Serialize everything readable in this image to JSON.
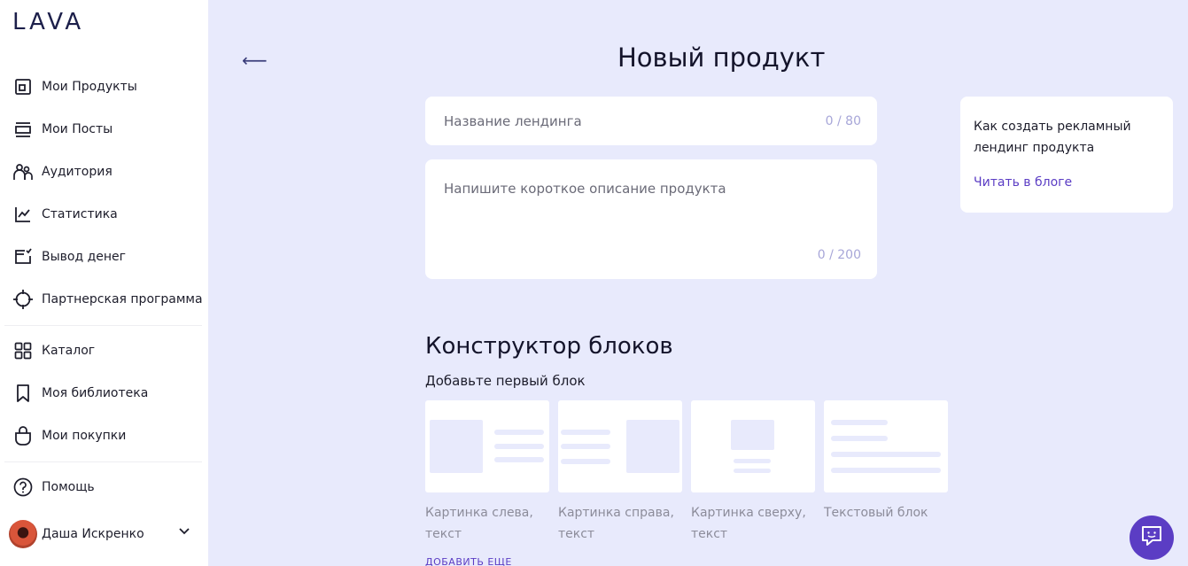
{
  "brand": {
    "logo": "LAVA"
  },
  "sidebar": {
    "items": [
      {
        "label": "Мои Продукты",
        "icon": "products-icon"
      },
      {
        "label": "Мои Посты",
        "icon": "posts-icon"
      },
      {
        "label": "Аудитория",
        "icon": "audience-icon"
      },
      {
        "label": "Статистика",
        "icon": "statistics-icon"
      },
      {
        "label": "Вывод денег",
        "icon": "withdraw-icon"
      },
      {
        "label": "Партнерская программа",
        "icon": "partner-icon"
      },
      {
        "label": "Каталог",
        "icon": "catalog-icon"
      },
      {
        "label": "Моя библиотека",
        "icon": "bookmark-icon"
      },
      {
        "label": "Мои покупки",
        "icon": "shopping-bag-icon"
      },
      {
        "label": "Помощь",
        "icon": "help-icon"
      }
    ],
    "user": {
      "name": "Даша Искренко"
    }
  },
  "header": {
    "back_symbol": "⟵",
    "title": "Новый продукт"
  },
  "form": {
    "landing_name": {
      "placeholder": "Название лендинга",
      "counter": "0 / 80"
    },
    "description": {
      "placeholder": "Напишите короткое описание продукта",
      "counter": "0 / 200"
    }
  },
  "tip": {
    "text": "Как создать рекламный лендинг продукта",
    "link": "Читать в блоге"
  },
  "constructor": {
    "title": "Конструктор блоков",
    "subtitle": "Добавьте первый блок",
    "blocks": [
      {
        "label": "Картинка слева, текст"
      },
      {
        "label": "Картинка справа, текст"
      },
      {
        "label": "Картинка сверху, текст"
      },
      {
        "label": "Текстовый блок"
      }
    ],
    "add_more": "ДОБАВИТЬ ЕЩЕ"
  },
  "colors": {
    "accent": "#5b3dc4",
    "background": "#e8eafc",
    "logo": "#1c1f4a"
  }
}
